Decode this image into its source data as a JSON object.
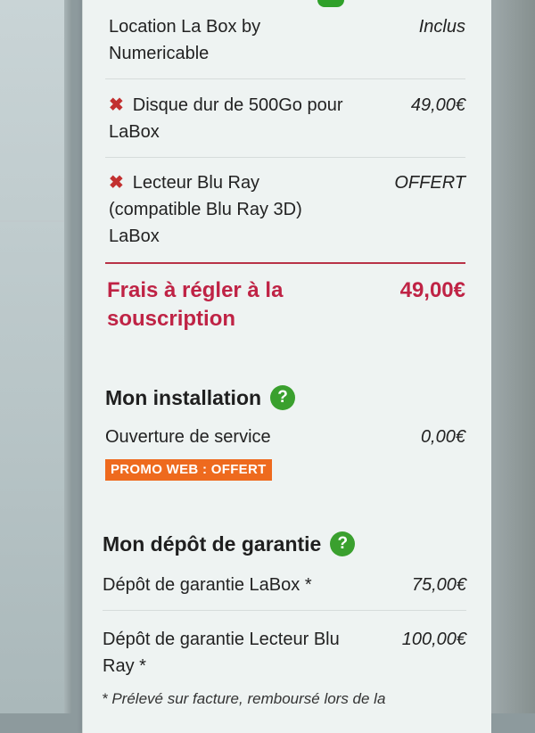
{
  "items": [
    {
      "label": "Location La Box by Numericable",
      "price": "Inclus",
      "removable": false
    },
    {
      "label": "Disque dur de 500Go pour LaBox",
      "price": "49,00€",
      "removable": true
    },
    {
      "label": "Lecteur Blu Ray (compatible Blu Ray 3D) LaBox",
      "price": "OFFERT",
      "removable": true
    }
  ],
  "total": {
    "label": "Frais à régler à la souscription",
    "price": "49,00€"
  },
  "installation": {
    "title": "Mon installation",
    "help_glyph": "?",
    "line_label": "Ouverture de service",
    "line_price": "0,00€",
    "promo": "PROMO WEB : OFFERT"
  },
  "deposit": {
    "title": "Mon dépôt de garantie",
    "help_glyph": "?",
    "lines": [
      {
        "label": "Dépôt de garantie LaBox *",
        "price": "75,00€"
      },
      {
        "label": "Dépôt de garantie Lecteur Blu Ray *",
        "price": "100,00€"
      }
    ],
    "footnote": "* Prélevé sur facture, remboursé lors de la"
  },
  "icons": {
    "remove": "close-icon",
    "help": "help-icon"
  },
  "colors": {
    "accent_red": "#bf2345",
    "help_green": "#3aa02e",
    "promo_orange": "#ee6a1e",
    "remove_red": "#c23030"
  }
}
